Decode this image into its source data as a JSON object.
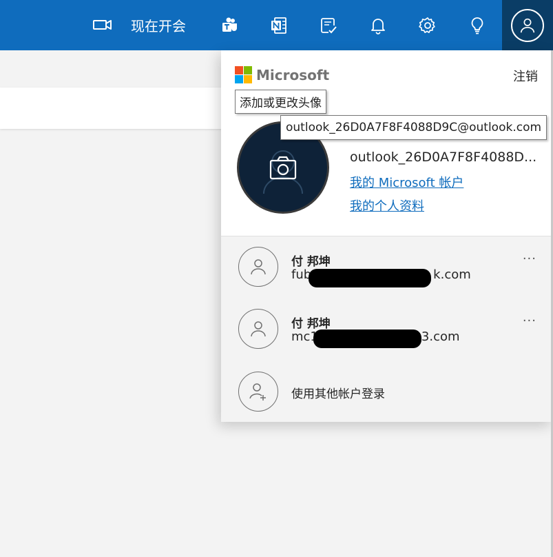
{
  "topbar": {
    "meet_label": "现在开会",
    "icons": [
      "video-icon",
      "teams-icon",
      "onenote-icon",
      "todo-icon",
      "bell-icon",
      "gear-icon",
      "lightbulb-icon"
    ],
    "bg_color": "#0f6cbd",
    "avatar_bg": "#0a3d66"
  },
  "panel": {
    "brand": "Microsoft",
    "signout_label": "注销",
    "avatar_tooltip": "添加或更改头像",
    "email_tooltip": "outlook_26D0A7F8F4088D9C@outlook.com",
    "account_email_truncated": "outlook_26D0A7F8F4088D...",
    "link_account": "我的 Microsoft 帐户",
    "link_profile": "我的个人资料"
  },
  "other_accounts": [
    {
      "name": "付 邦坤",
      "email_prefix": "fub",
      "email_suffix": "k.com"
    },
    {
      "name": "付 邦坤",
      "email_prefix": "mc1",
      "email_suffix": "3.com"
    }
  ],
  "add_account_label": "使用其他帐户登录",
  "more_label": "···"
}
